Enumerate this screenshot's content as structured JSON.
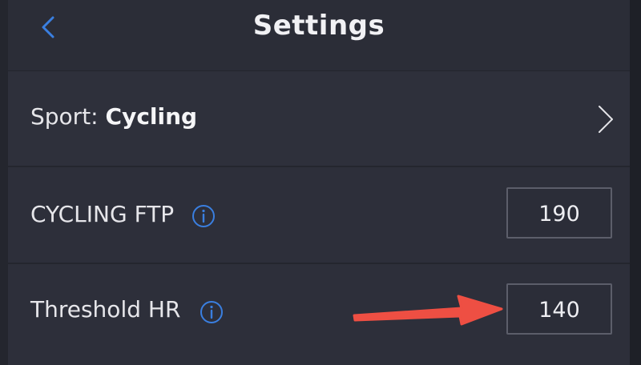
{
  "header": {
    "title": "Settings",
    "back_icon": "chevron-left-icon"
  },
  "sport_row": {
    "prefix": "Sport:",
    "value": "Cycling",
    "chevron_icon": "chevron-right-icon"
  },
  "ftp_row": {
    "label": "CYCLING FTP",
    "value": "190",
    "info_icon": "info-icon"
  },
  "hr_row": {
    "label": "Threshold HR",
    "value": "140",
    "info_icon": "info-icon"
  },
  "annotation": {
    "arrow_color": "#ee4f43"
  },
  "colors": {
    "accent": "#3a7fe0",
    "background": "#2a2c36",
    "text": "#e6e6ea"
  }
}
